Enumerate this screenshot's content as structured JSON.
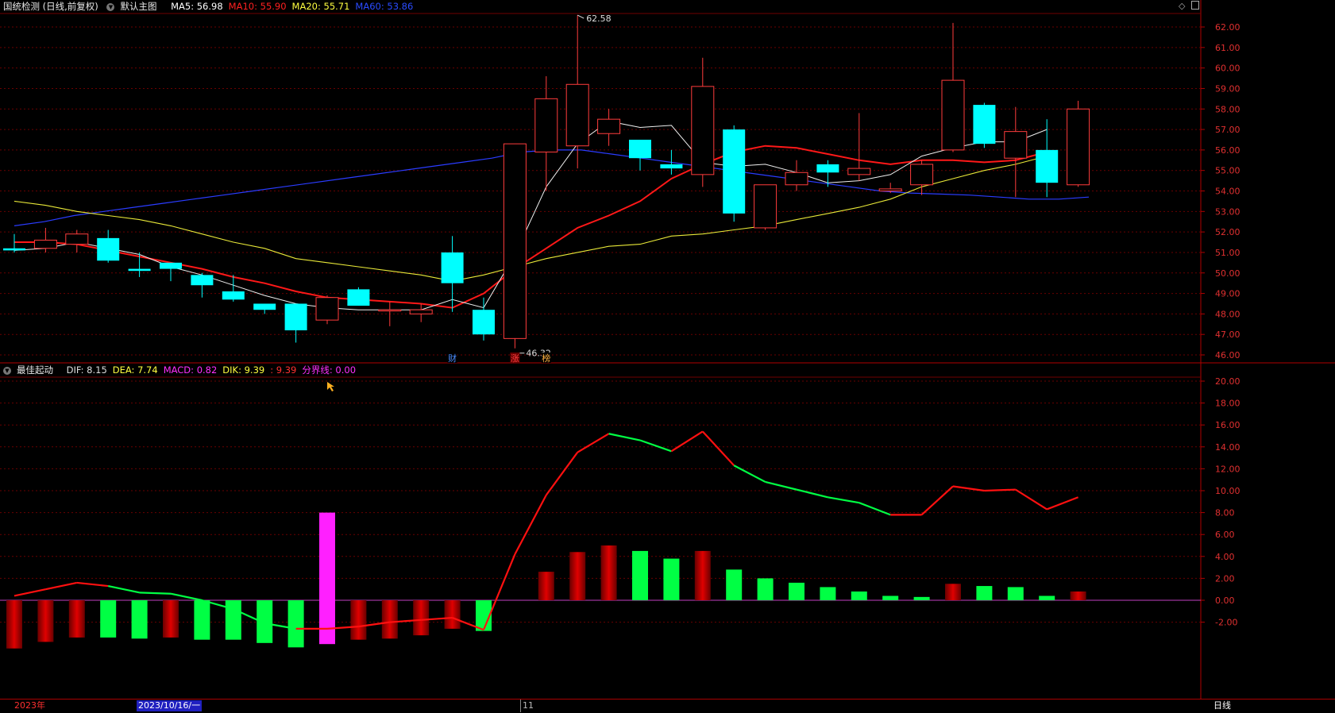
{
  "header": {
    "title": "国统检测 (日线,前复权)",
    "template": "默认主图",
    "ma": [
      {
        "label": "MA5: 56.98",
        "color": "#ffffff"
      },
      {
        "label": "MA10: 55.90",
        "color": "#ff2020"
      },
      {
        "label": "MA20: 55.71",
        "color": "#ffff40"
      },
      {
        "label": "MA60: 53.86",
        "color": "#2a4bff"
      }
    ],
    "icons": [
      "diamond-icon",
      "window-icon"
    ]
  },
  "sub_header": {
    "name": "最佳起动",
    "items": [
      {
        "label": "DIF: 8.15",
        "color": "#dddddd"
      },
      {
        "label": "DEA: 7.74",
        "color": "#ffff40"
      },
      {
        "label": "MACD: 0.82",
        "color": "#ff30ff"
      },
      {
        "label": "DIK: 9.39",
        "color": "#ffff40"
      },
      {
        "label": ": 9.39",
        "color": "#ff3030"
      },
      {
        "label": "分界线: 0.00",
        "color": "#ff30ff"
      }
    ]
  },
  "price_axis": {
    "labels": [
      "62.00",
      "61.00",
      "60.00",
      "59.00",
      "58.00",
      "57.00",
      "56.00",
      "55.00",
      "54.00",
      "53.00",
      "52.00",
      "51.00",
      "50.00",
      "49.00",
      "48.00",
      "47.00",
      "46.00"
    ],
    "min": 46,
    "max": 62
  },
  "macd_axis": {
    "labels": [
      "20.00",
      "18.00",
      "16.00",
      "14.00",
      "12.00",
      "10.00",
      "8.00",
      "6.00",
      "4.00",
      "2.00",
      "0.00",
      "-2.00"
    ],
    "min": -2,
    "max": 20
  },
  "annotations": {
    "high": "62.58",
    "low": "46.32",
    "markers": [
      "财",
      "涨",
      "榜"
    ]
  },
  "bottom": {
    "year": "2023年",
    "cursor_date": "2023/10/16/一",
    "month": "11",
    "period": "日线"
  },
  "chart_data": [
    {
      "type": "candlestick",
      "title": "国统检测 (日线,前复权)",
      "ylim": [
        46,
        62
      ],
      "candles": [
        {
          "o": 51.2,
          "h": 51.9,
          "l": 51.0,
          "c": 51.1
        },
        {
          "o": 51.2,
          "h": 52.2,
          "l": 51.0,
          "c": 51.6
        },
        {
          "o": 51.4,
          "h": 52.1,
          "l": 51.0,
          "c": 51.9
        },
        {
          "o": 51.7,
          "h": 52.1,
          "l": 50.5,
          "c": 50.6
        },
        {
          "o": 50.2,
          "h": 51.0,
          "l": 49.8,
          "c": 50.1
        },
        {
          "o": 50.5,
          "h": 50.5,
          "l": 49.6,
          "c": 50.2
        },
        {
          "o": 49.9,
          "h": 50.0,
          "l": 48.8,
          "c": 49.4
        },
        {
          "o": 49.1,
          "h": 49.9,
          "l": 48.6,
          "c": 48.7
        },
        {
          "o": 48.5,
          "h": 48.5,
          "l": 48.0,
          "c": 48.2
        },
        {
          "o": 48.5,
          "h": 48.5,
          "l": 46.6,
          "c": 47.2
        },
        {
          "o": 47.7,
          "h": 48.9,
          "l": 47.5,
          "c": 48.8
        },
        {
          "o": 49.2,
          "h": 49.3,
          "l": 48.4,
          "c": 48.4
        },
        {
          "o": 48.2,
          "h": 48.6,
          "l": 47.4,
          "c": 48.2
        },
        {
          "o": 48.0,
          "h": 48.5,
          "l": 47.6,
          "c": 48.2
        },
        {
          "o": 51.0,
          "h": 51.8,
          "l": 48.1,
          "c": 49.5
        },
        {
          "o": 48.2,
          "h": 48.8,
          "l": 46.7,
          "c": 47.0
        },
        {
          "o": 46.8,
          "h": 56.3,
          "l": 46.32,
          "c": 56.3
        },
        {
          "o": 55.9,
          "h": 59.6,
          "l": 54.0,
          "c": 58.5
        },
        {
          "o": 56.2,
          "h": 62.58,
          "l": 55.1,
          "c": 59.2
        },
        {
          "o": 56.8,
          "h": 58.0,
          "l": 56.2,
          "c": 57.5
        },
        {
          "o": 56.5,
          "h": 56.5,
          "l": 55.0,
          "c": 55.6
        },
        {
          "o": 55.3,
          "h": 56.0,
          "l": 54.8,
          "c": 55.1
        },
        {
          "o": 54.8,
          "h": 60.5,
          "l": 54.2,
          "c": 59.1
        },
        {
          "o": 57.0,
          "h": 57.2,
          "l": 52.5,
          "c": 52.9
        },
        {
          "o": 52.2,
          "h": 54.3,
          "l": 52.1,
          "c": 54.3
        },
        {
          "o": 54.3,
          "h": 55.5,
          "l": 54.0,
          "c": 54.9
        },
        {
          "o": 55.3,
          "h": 55.5,
          "l": 54.2,
          "c": 54.9
        },
        {
          "o": 54.8,
          "h": 57.8,
          "l": 54.5,
          "c": 55.1
        },
        {
          "o": 54.0,
          "h": 54.4,
          "l": 53.9,
          "c": 54.1
        },
        {
          "o": 54.3,
          "h": 55.5,
          "l": 53.8,
          "c": 55.3
        },
        {
          "o": 56.0,
          "h": 62.2,
          "l": 55.9,
          "c": 59.4
        },
        {
          "o": 58.2,
          "h": 58.3,
          "l": 56.1,
          "c": 56.3
        },
        {
          "o": 55.6,
          "h": 58.1,
          "l": 53.7,
          "c": 56.9
        },
        {
          "o": 56.0,
          "h": 57.5,
          "l": 53.7,
          "c": 54.4
        },
        {
          "o": 54.3,
          "h": 58.4,
          "l": 54.2,
          "c": 58.0
        }
      ],
      "ma5": [
        51.1,
        51.2,
        51.5,
        51.2,
        50.9,
        50.3,
        49.9,
        49.4,
        48.9,
        48.5,
        48.3,
        48.2,
        48.2,
        48.2,
        48.7,
        48.3,
        50.9,
        54.2,
        56.3,
        57.4,
        57.1,
        57.2,
        55.4,
        55.2,
        55.3,
        54.9,
        54.4,
        54.5,
        54.8,
        55.7,
        56.1,
        56.4,
        56.4,
        57.0
      ],
      "ma10": [
        51.5,
        51.5,
        51.4,
        51.1,
        50.8,
        50.5,
        50.2,
        49.8,
        49.5,
        49.1,
        48.8,
        48.7,
        48.6,
        48.5,
        48.3,
        49.0,
        50.2,
        51.2,
        52.2,
        52.8,
        53.5,
        54.6,
        55.3,
        55.9,
        56.2,
        56.1,
        55.8,
        55.5,
        55.3,
        55.5,
        55.5,
        55.4,
        55.5,
        55.9
      ],
      "ma20": [
        53.5,
        53.3,
        53.0,
        52.8,
        52.6,
        52.3,
        51.9,
        51.5,
        51.2,
        50.7,
        50.5,
        50.3,
        50.1,
        49.9,
        49.6,
        49.9,
        50.3,
        50.7,
        51.0,
        51.3,
        51.4,
        51.8,
        51.9,
        52.1,
        52.3,
        52.6,
        52.9,
        53.2,
        53.6,
        54.2,
        54.6,
        55.0,
        55.3,
        55.7
      ],
      "ma60": [
        52.3,
        52.5,
        52.8,
        53.0,
        53.2,
        53.4,
        53.6,
        53.8,
        54.0,
        54.2,
        54.4,
        54.6,
        54.8,
        55.0,
        55.2,
        55.4,
        55.6,
        55.9,
        56.0,
        56.0,
        55.8,
        55.6,
        55.4,
        55.2,
        55.0,
        54.8,
        54.6,
        54.4,
        54.2,
        54.0,
        53.9,
        53.85,
        53.8,
        53.7,
        53.6,
        53.6,
        53.7
      ]
    },
    {
      "type": "bar",
      "title": "最佳起动",
      "ylim": [
        -2,
        20
      ],
      "macd": [
        -4.4,
        -3.8,
        -3.4,
        -3.4,
        -3.5,
        -3.4,
        -3.6,
        -3.6,
        -3.9,
        -4.3,
        -4.0,
        -3.6,
        -3.5,
        -3.2,
        -2.6,
        -2.8,
        0,
        2.6,
        4.4,
        5.0,
        4.5,
        3.8,
        4.5,
        2.8,
        2.0,
        1.6,
        1.2,
        0.8,
        0.4,
        0.3,
        1.5,
        1.3,
        1.2,
        0.4,
        0.8
      ],
      "macd_colors": [
        "r",
        "r",
        "r",
        "g",
        "g",
        "r",
        "g",
        "g",
        "g",
        "g",
        "m",
        "r",
        "r",
        "r",
        "r",
        "g",
        "n",
        "r",
        "r",
        "r",
        "g",
        "g",
        "r",
        "g",
        "g",
        "g",
        "g",
        "g",
        "g",
        "g",
        "r",
        "g",
        "g",
        "g",
        "r"
      ],
      "dif": [
        0.4,
        1.0,
        1.6,
        1.3,
        0.7,
        0.6,
        0.0,
        -0.8,
        -2.1,
        -2.6,
        -2.6,
        -2.4,
        -2.0,
        -1.8,
        -1.6,
        -2.7,
        4.2,
        9.6,
        13.5,
        15.2,
        14.6,
        13.6,
        15.4,
        12.3,
        10.8,
        10.1,
        9.4,
        8.9,
        7.8,
        7.8,
        10.4,
        10.0,
        10.1,
        8.3,
        9.4
      ],
      "dif_colors": [
        "r",
        "r",
        "r",
        "g",
        "g",
        "g",
        "g",
        "g",
        "g",
        "r",
        "r",
        "r",
        "r",
        "r",
        "r",
        "r",
        "r",
        "r",
        "r",
        "g",
        "g",
        "r",
        "r",
        "g",
        "g",
        "g",
        "g",
        "g",
        "r",
        "r",
        "r",
        "r",
        "r",
        "r"
      ]
    }
  ]
}
